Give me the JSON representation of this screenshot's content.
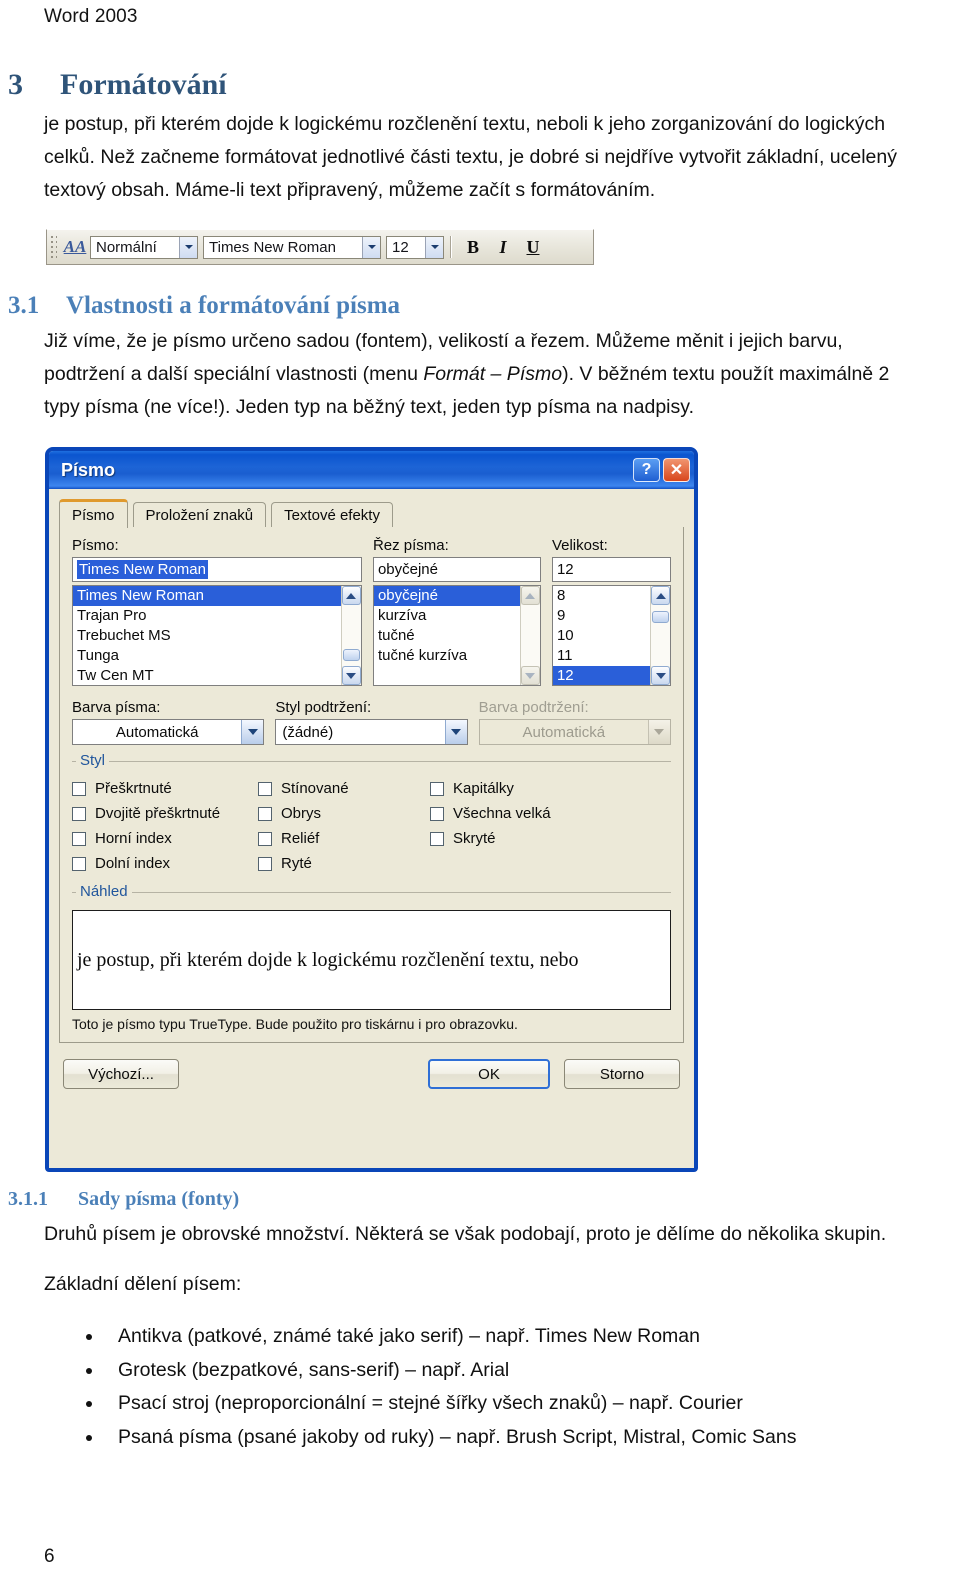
{
  "running_header": "Word 2003",
  "page_number": "6",
  "headings": {
    "h1_num": "3",
    "h1_text": "Formátování",
    "h2_num": "3.1",
    "h2_text": "Vlastnosti a formátování písma",
    "h3_num": "3.1.1",
    "h3_text": "Sady písma (fonty)"
  },
  "paragraphs": {
    "intro": "je postup, při kterém dojde k logickému rozčlenění textu, neboli k jeho zorganizování do logických celků. Než začneme formátovat jednotlivé části textu, je dobré si nejdříve vytvořit základní, ucelený textový obsah. Máme-li text připravený, můžeme začít s formátováním.",
    "p31_a": "Již víme, že je písmo určeno sadou (fontem), velikostí a řezem. Můžeme měnit i jejich barvu, podtržení a další speciální vlastnosti (menu ",
    "p31_menu1": "Formát – Písmo",
    "p31_b": ").  V běžném textu použít maximálně 2 typy písma (ne více!). Jeden typ na běžný text, jeden typ písma na nadpisy.",
    "p311": "Druhů písem je obrovské množství. Některá se však podobají, proto je dělíme do několika skupin.",
    "zakladni": "Základní dělení písem:"
  },
  "bullets": [
    "Antikva (patkové, známé také jako serif) – např. Times New Roman",
    "Grotesk (bezpatkové, sans-serif) – např. Arial",
    "Psací stroj (neproporcionální = stejné šířky všech znaků) – např. Courier",
    "Psaná písma (psané jakoby od ruky) – např. Brush Script, Mistral, Comic Sans"
  ],
  "toolbar": {
    "style_icon": "AA",
    "style_value": "Normální",
    "font_value": "Times New Roman",
    "size_value": "12",
    "bold_label": "B",
    "italic_label": "I",
    "underline_label": "U"
  },
  "dialog": {
    "title": "Písmo",
    "help_button": "?",
    "close_button": "✕",
    "tabs": [
      {
        "label": "Písmo",
        "active": true
      },
      {
        "label": "Proložení znaků",
        "active": false
      },
      {
        "label": "Textové efekty",
        "active": false
      }
    ],
    "font_label": "Písmo:",
    "font_value": "Times New Roman",
    "font_list": [
      "Times New Roman",
      "Trajan Pro",
      "Trebuchet MS",
      "Tunga",
      "Tw Cen MT"
    ],
    "font_selected": "Times New Roman",
    "style_label": "Řez písma:",
    "style_value": "obyčejné",
    "style_list": [
      "obyčejné",
      "kurzíva",
      "tučné",
      "tučné kurzíva"
    ],
    "style_selected": "obyčejné",
    "size_label": "Velikost:",
    "size_value": "12",
    "size_list": [
      "8",
      "9",
      "10",
      "11",
      "12"
    ],
    "size_selected": "12",
    "color_label": "Barva písma:",
    "color_value": "Automatická",
    "underline_style_label": "Styl podtržení:",
    "underline_style_value": "(žádné)",
    "underline_color_label": "Barva podtržení:",
    "underline_color_value": "Automatická",
    "style_group_label": "Styl",
    "checks_col1": [
      "Přeškrtnuté",
      "Dvojitě přeškrtnuté",
      "Horní index",
      "Dolní index"
    ],
    "checks_col2": [
      "Stínované",
      "Obrys",
      "Reliéf",
      "Ryté"
    ],
    "checks_col3": [
      "Kapitálky",
      "Všechna velká",
      "Skryté"
    ],
    "preview_group_label": "Náhled",
    "preview_text": "je postup, při kterém dojde k logickému rozčlenění textu, nebo",
    "note": "Toto je písmo typu TrueType. Bude použito pro tiskárnu i pro obrazovku.",
    "default_button": "Výchozí...",
    "ok_button": "OK",
    "cancel_button": "Storno"
  },
  "colors": {
    "heading1": "#2f5479",
    "heading2": "#4b80b8",
    "dialog_titlebar": "#1a5ed0",
    "selection": "#2a5fd9",
    "dialog_face": "#ece9d8",
    "group_label": "#21569c"
  }
}
